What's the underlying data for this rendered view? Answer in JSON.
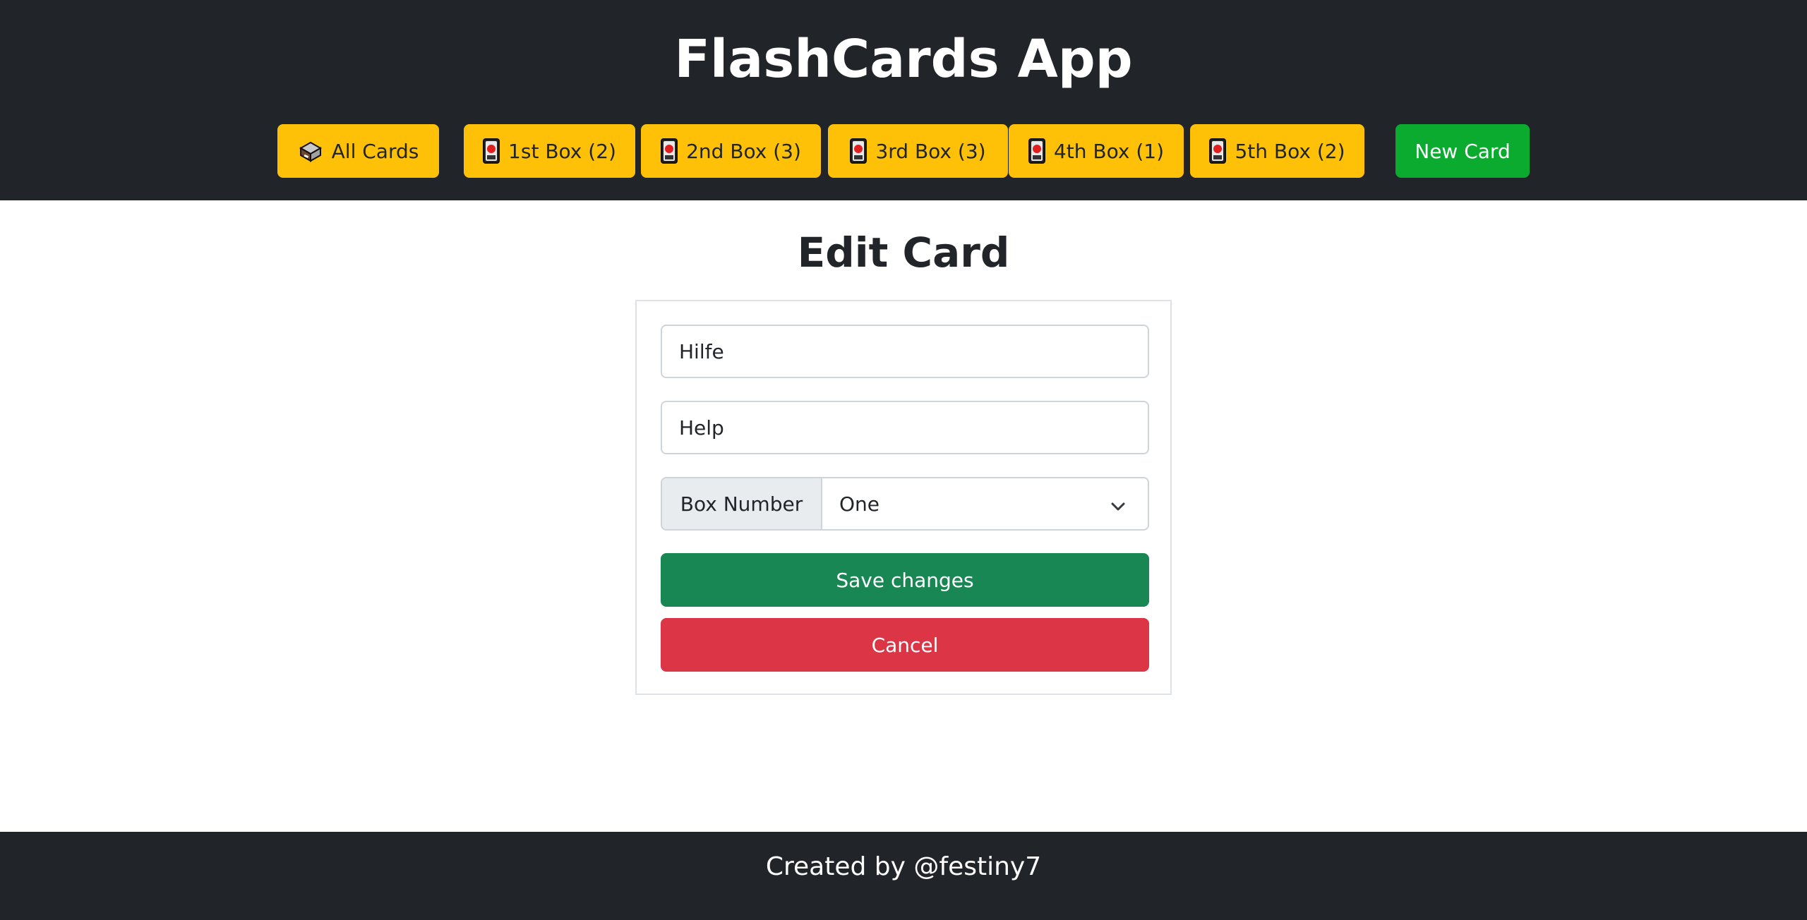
{
  "header": {
    "title": "FlashCards App",
    "nav": {
      "all_cards": "All Cards",
      "boxes": [
        {
          "label": "1st Box (2)"
        },
        {
          "label": "2nd Box (3)"
        },
        {
          "label": "3rd Box (3)"
        },
        {
          "label": "4th Box (1)"
        },
        {
          "label": "5th Box (2)"
        }
      ],
      "new_card": "New Card"
    }
  },
  "main": {
    "title": "Edit Card",
    "form": {
      "front_value": "Hilfe",
      "back_value": "Help",
      "box_number_label": "Box Number",
      "box_number_selected": "One",
      "save_label": "Save changes",
      "cancel_label": "Cancel"
    }
  },
  "footer": {
    "text": "Created by @festiny7"
  },
  "icons": {
    "all_cards": "card-file-box-icon",
    "box": "joker-card-icon",
    "select": "chevron-down-icon"
  },
  "colors": {
    "header_bg": "#212529",
    "nav_button": "#ffc107",
    "new_card_button": "#0aab2f",
    "save_button": "#198754",
    "cancel_button": "#dc3545"
  }
}
